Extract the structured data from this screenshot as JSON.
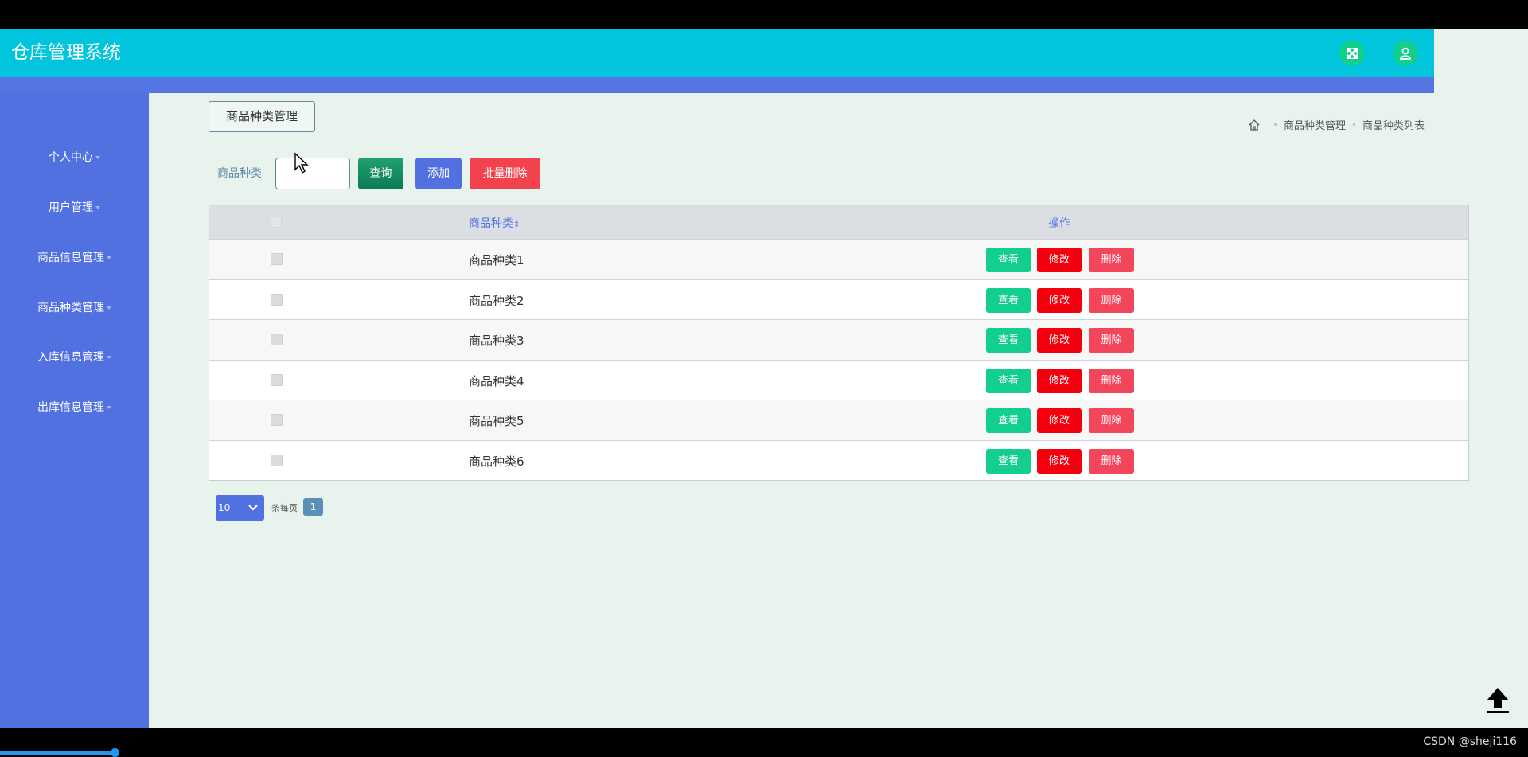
{
  "app": {
    "title": "仓库管理系统"
  },
  "header": {
    "fullscreen_icon": "fullscreen-icon",
    "user_icon": "user-icon"
  },
  "sidebar": {
    "items": [
      {
        "label": "个人中心"
      },
      {
        "label": "用户管理"
      },
      {
        "label": "商品信息管理"
      },
      {
        "label": "商品种类管理"
      },
      {
        "label": "入库信息管理"
      },
      {
        "label": "出库信息管理"
      }
    ]
  },
  "page": {
    "tag": "商品种类管理",
    "breadcrumb": [
      "商品种类管理",
      "商品种类列表"
    ]
  },
  "search": {
    "label": "商品种类",
    "value": "",
    "query_label": "查询",
    "add_label": "添加",
    "batch_delete_label": "批量删除"
  },
  "table": {
    "headers": {
      "name": "商品种类",
      "ops": "操作"
    },
    "rows": [
      {
        "name": "商品种类1"
      },
      {
        "name": "商品种类2"
      },
      {
        "name": "商品种类3"
      },
      {
        "name": "商品种类4"
      },
      {
        "name": "商品种类5"
      },
      {
        "name": "商品种类6"
      }
    ],
    "op_labels": {
      "view": "查看",
      "edit": "修改",
      "delete": "删除"
    }
  },
  "pager": {
    "page_size": "10",
    "per_page_text": "条每页",
    "current": "1"
  },
  "watermark": "CSDN @sheji116",
  "colors": {
    "header": "#00c5dc",
    "sidebar": "#5171e0",
    "accent_green": "#13cf8e",
    "danger": "#f2000d"
  }
}
